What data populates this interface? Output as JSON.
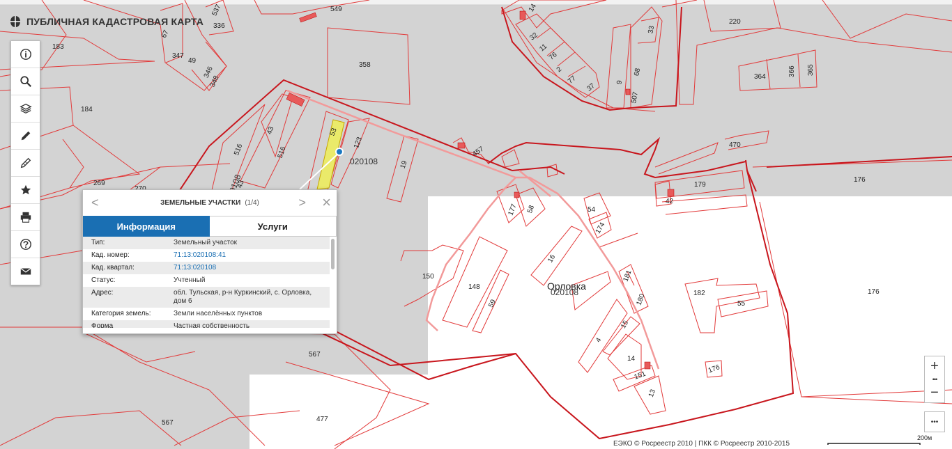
{
  "header": {
    "title": "ПУБЛИЧНАЯ КАДАСТРОВАЯ КАРТА"
  },
  "toolbar": [
    {
      "name": "info-icon"
    },
    {
      "name": "search-icon"
    },
    {
      "name": "layers-icon"
    },
    {
      "name": "pencil-icon"
    },
    {
      "name": "measure-icon"
    },
    {
      "name": "star-icon"
    },
    {
      "name": "print-icon"
    },
    {
      "name": "help-icon"
    },
    {
      "name": "mail-icon"
    }
  ],
  "popup": {
    "title": "ЗЕМЕЛЬНЫЕ УЧАСТКИ",
    "counter": "(1/4)",
    "prev": "<",
    "next": ">",
    "close": "×",
    "tab_info": "Информация",
    "tab_services": "Услуги",
    "rows": [
      {
        "key": "Тип:",
        "value": "Земельный участок",
        "link": false
      },
      {
        "key": "Кад. номер:",
        "value": "71:13:020108:41",
        "link": true
      },
      {
        "key": "Кад. квартал:",
        "value": "71:13:020108",
        "link": true
      },
      {
        "key": "Статус:",
        "value": "Учтенный",
        "link": false
      },
      {
        "key": "Адрес:",
        "value": "обл. Тульская, р-н Куркинский, с. Орловка, дом 6",
        "link": false
      },
      {
        "key": "Категория земель:",
        "value": "Земли населённых пунктов",
        "link": false
      },
      {
        "key": "Форма",
        "value": "Частная собственность",
        "link": false
      }
    ]
  },
  "map": {
    "place_name": "Орловка",
    "quarter_labels": [
      "020108",
      "020108",
      "020108"
    ],
    "parcels": [
      "549",
      "14",
      "220",
      "183",
      "67",
      "537",
      "336",
      "347",
      "49",
      "346",
      "348",
      "358",
      "32",
      "11",
      "76",
      "2",
      "77",
      "37",
      "9",
      "68",
      "507",
      "33",
      "364",
      "366",
      "365",
      "184",
      "516",
      "43",
      "516",
      "43",
      "53",
      "123",
      "19",
      "457",
      "470",
      "179",
      "176",
      "42",
      "269",
      "270",
      "177",
      "58",
      "54",
      "174",
      "16",
      "181",
      "180",
      "150",
      "148",
      "59",
      "182",
      "55",
      "176",
      "4",
      "15",
      "14",
      "151",
      "13",
      "567",
      "567",
      "477",
      "176"
    ]
  },
  "zoom": {
    "in": "+",
    "out": "−",
    "more": "•••"
  },
  "attribution": "ЕЭКО © Росреестр 2010 | ПКК © Росреестр 2010-2015",
  "scale": "200м"
}
